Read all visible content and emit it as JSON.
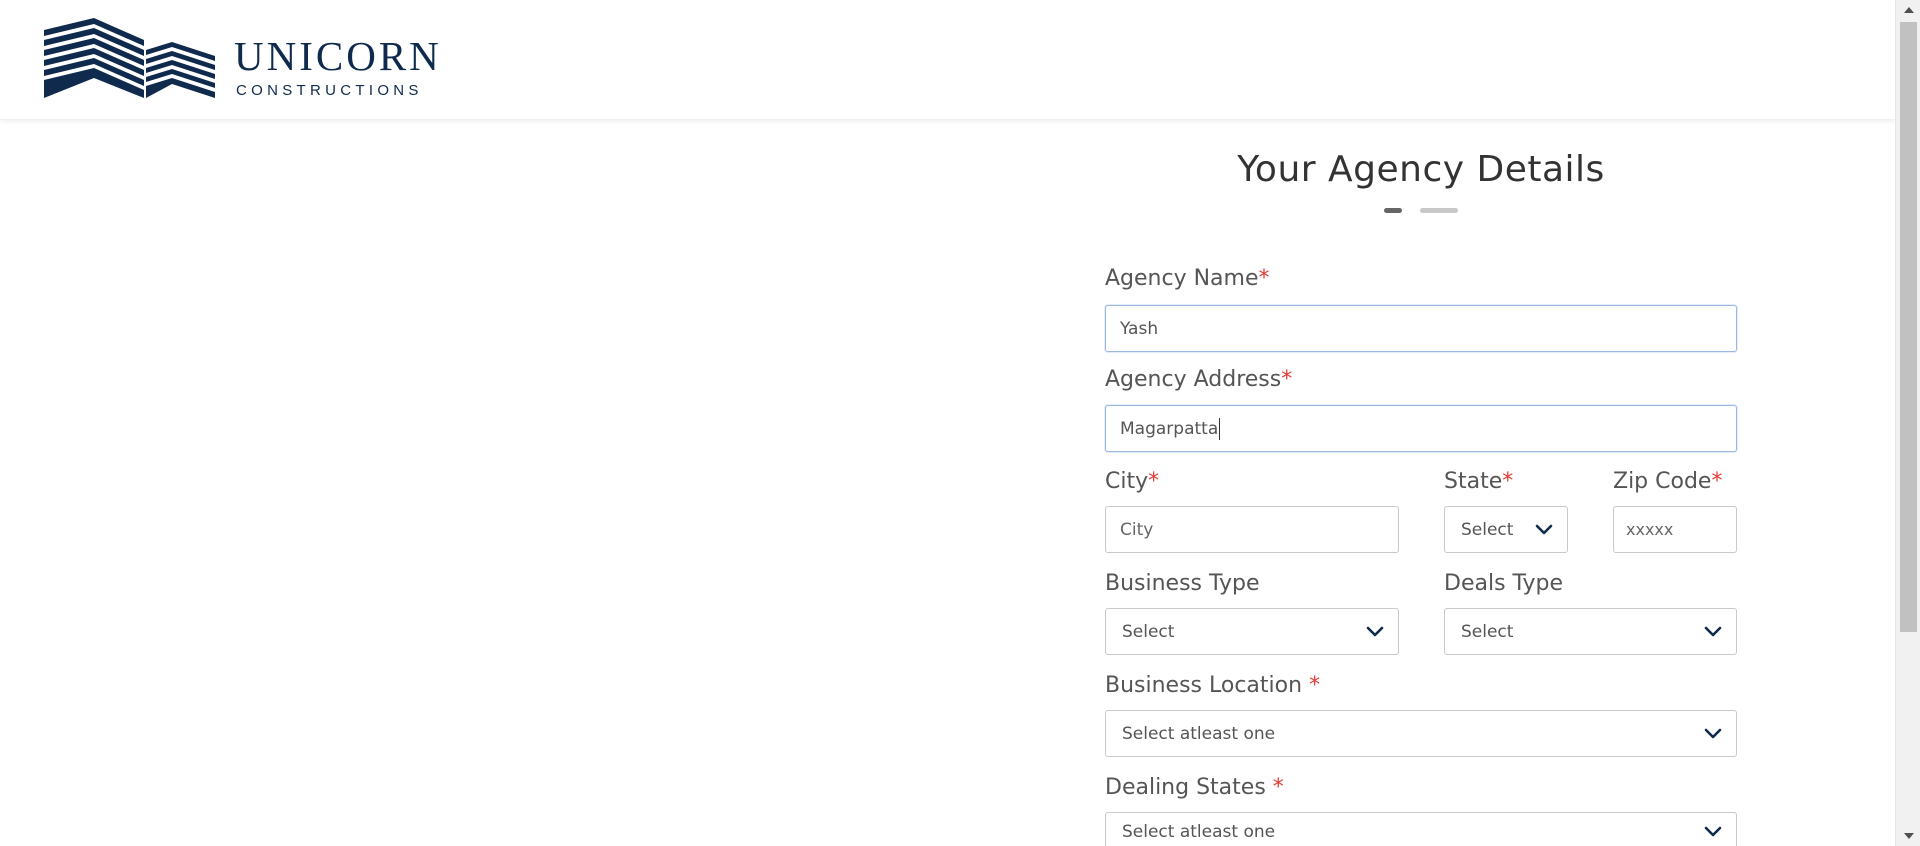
{
  "brand": {
    "title": "UNICORN",
    "subtitle": "CONSTRUCTIONS"
  },
  "form": {
    "title": "Your Agency Details",
    "steps": {
      "current": 1,
      "total": 2
    },
    "agency_name": {
      "label": "Agency Name",
      "required": "*",
      "value": "Yash"
    },
    "agency_address": {
      "label": "Agency Address",
      "required": "*",
      "value": "Magarpatta"
    },
    "city": {
      "label": "City",
      "required": "*",
      "placeholder": "City"
    },
    "state": {
      "label": "State",
      "required": "*",
      "selected": "Select"
    },
    "zip": {
      "label": "Zip Code",
      "required": "*",
      "placeholder": "xxxxx"
    },
    "business_type": {
      "label": "Business Type",
      "selected": "Select"
    },
    "deals_type": {
      "label": "Deals Type",
      "selected": "Select"
    },
    "business_location": {
      "label": "Business Location ",
      "required": "*",
      "selected": "Select atleast one"
    },
    "dealing_states": {
      "label": "Dealing States ",
      "required": "*",
      "selected": "Select atleast one"
    }
  },
  "colors": {
    "brand_navy": "#0f2a4d",
    "required_red": "#e53935",
    "focus_border": "#9ab8e0"
  },
  "icons": {
    "dropdown": "chevron-down-icon",
    "scroll_up": "scroll-up-arrow-icon",
    "scroll_down": "scroll-down-arrow-icon"
  }
}
